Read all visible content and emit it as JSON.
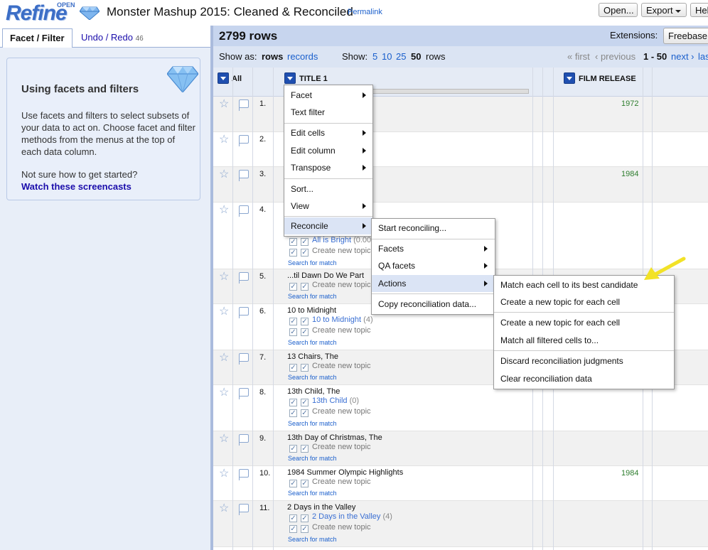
{
  "header": {
    "logo_word": "Refine",
    "logo_open": "OPEN",
    "project_title": "Monster Mashup 2015: Cleaned & Reconciled",
    "permalink": "Permalink",
    "buttons": {
      "open": "Open...",
      "export": "Export",
      "help": "Hel"
    }
  },
  "left_panel": {
    "tabs": {
      "facet_filter": "Facet / Filter",
      "undo_redo": "Undo / Redo",
      "undo_count": "46"
    },
    "help": {
      "title": "Using facets and filters",
      "text": "Use facets and filters to select subsets of your data to act on. Choose facet and filter methods from the menus at the top of each data column.",
      "question": "Not sure how to get started?",
      "link": "Watch these screencasts"
    }
  },
  "summary": {
    "rows": "2799 rows",
    "extensions_label": "Extensions:",
    "extensions_button": "Freebase"
  },
  "view_bar": {
    "show_as": "Show as:",
    "rows": "rows",
    "records": "records",
    "show": "Show:",
    "sizes": [
      "5",
      "10",
      "25",
      "50"
    ],
    "unit": "rows",
    "first": "« first",
    "previous": "‹ previous",
    "range": "1 - 50",
    "next": "next ›",
    "last": "las"
  },
  "columns": {
    "all": "All",
    "title": "TITLE 1",
    "film_release": "FILM RELEASE"
  },
  "rows": [
    {
      "num": "1.",
      "year": "1972"
    },
    {
      "num": "2.",
      "year": ""
    },
    {
      "num": "3.",
      "year": "1984"
    },
    {
      "num": "4.",
      "year": "",
      "candidate": "All is Bright",
      "score": "(0.00",
      "new_topic": "Create new topic",
      "search": "Search for match"
    },
    {
      "num": "5.",
      "year": "",
      "text": "...til Dawn Do We Part",
      "new_topic": "Create new topic",
      "search": "Search for match"
    },
    {
      "num": "6.",
      "year": "",
      "text": "10 to Midnight",
      "candidate": "10 to Midnight",
      "score": "(4)",
      "new_topic": "Create new topic",
      "search": "Search for match"
    },
    {
      "num": "7.",
      "year": "",
      "text": "13 Chairs, The",
      "new_topic": "Create new topic",
      "search": "Search for match"
    },
    {
      "num": "8.",
      "year": "",
      "text": "13th Child, The",
      "candidate": "13th Child",
      "score": "(0)",
      "new_topic": "Create new topic",
      "search": "Search for match"
    },
    {
      "num": "9.",
      "year": "",
      "text": "13th Day of Christmas, The",
      "new_topic": "Create new topic",
      "search": "Search for match"
    },
    {
      "num": "10.",
      "year": "1984",
      "text": "1984 Summer Olympic Highlights",
      "new_topic": "Create new topic",
      "search": "Search for match"
    },
    {
      "num": "11.",
      "year": "",
      "text": "2 Days in the Valley",
      "candidate": "2 Days in the Valley",
      "score": "(4)",
      "new_topic": "Create new topic",
      "search": "Search for match"
    }
  ],
  "menus": {
    "column_menu": [
      "Facet",
      "Text filter",
      "Edit cells",
      "Edit column",
      "Transpose",
      "Sort...",
      "View",
      "Reconcile"
    ],
    "reconcile_menu": [
      "Start reconciling...",
      "Facets",
      "QA facets",
      "Actions",
      "Copy reconciliation data..."
    ],
    "actions_menu": [
      "Match each cell to its best candidate",
      "Create a new topic for each cell",
      "Create a new topic for each cell",
      "Match all filtered cells to...",
      "Discard reconciliation judgments",
      "Clear reconciliation data"
    ]
  },
  "colors": {
    "accent": "#3c6ec6",
    "panel": "#e8eef8",
    "highlight": "#dbe4f5",
    "year_green": "#2e7d2e",
    "pointer_yellow": "#f2e227"
  }
}
